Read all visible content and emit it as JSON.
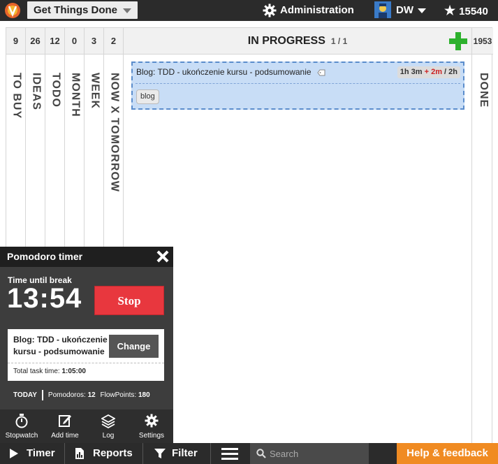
{
  "topbar": {
    "board_name": "Get Things Done",
    "admin_label": "Administration",
    "user_initials": "DW",
    "points": "15540"
  },
  "board": {
    "columns": [
      {
        "count": "9",
        "title": "TO BUY"
      },
      {
        "count": "26",
        "title": "IDEAS"
      },
      {
        "count": "12",
        "title": "TODO"
      },
      {
        "count": "0",
        "title": "MONTH"
      },
      {
        "count": "3",
        "title": "WEEK"
      },
      {
        "count": "2",
        "title": "NOW X TOMORROW"
      }
    ],
    "in_progress": {
      "title": "IN PROGRESS",
      "count": "1 / 1",
      "card": {
        "title": "Blog: TDD - ukończenie kursu - podsumowanie",
        "time_main": "1h 3m",
        "time_added": "+ 2m",
        "time_total": "/ 2h",
        "tag": "blog"
      }
    },
    "done": {
      "count": "1953",
      "title": "DONE"
    }
  },
  "pomodoro": {
    "title": "Pomodoro timer",
    "until_label": "Time until break",
    "clock": "13:54",
    "stop_label": "Stop",
    "task_name": "Blog: TDD - ukończenie kursu - podsumowanie",
    "change_label": "Change",
    "total_label": "Total task time:",
    "total_value": "1:05:00",
    "today_label": "TODAY",
    "pomodoros_label": "Pomodoros:",
    "pomodoros_value": "12",
    "flowpoints_label": "FlowPoints:",
    "flowpoints_value": "180",
    "tools": [
      "Stopwatch",
      "Add time",
      "Log",
      "Settings"
    ]
  },
  "bottombar": {
    "timer": "Timer",
    "reports": "Reports",
    "filter": "Filter",
    "search_placeholder": "Search",
    "help": "Help & feedback"
  },
  "colors": {
    "bar": "#2b2b2b",
    "card_bg": "#c8ddf6",
    "stop": "#e8373e",
    "help": "#f08b22",
    "add": "#2db12d"
  }
}
